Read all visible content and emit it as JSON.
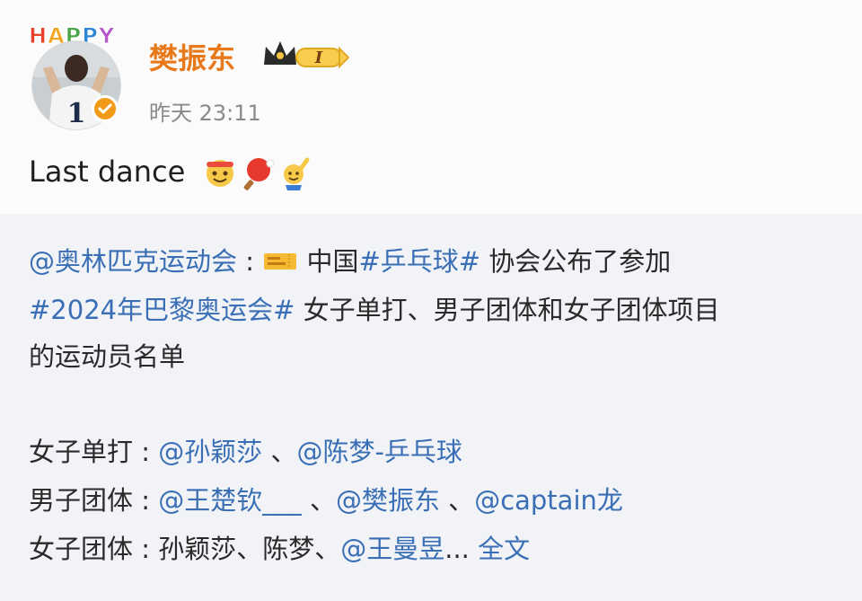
{
  "header": {
    "badge_text": "HAPPY",
    "username": "樊振东",
    "level_badge": "I",
    "timestamp": "昨天 23:11",
    "jersey_number": "1"
  },
  "post": {
    "text": "Last dance"
  },
  "repost": {
    "line1_mention": "@奥林匹克运动会",
    "line1_colon": " :",
    "line1_text1": " 中国",
    "line1_hashtag": "#乒乓球#",
    "line1_text2": " 协会公布了参加",
    "line2_hashtag": "#2024年巴黎奥运会#",
    "line2_text": " 女子单打、男子团体和女子团体项目",
    "line3_text": "的运动员名单",
    "line4_label": "女子单打 : ",
    "line4_m1": "@孙颖莎",
    "line4_sep": " 、",
    "line4_m2": "@陈梦-乒乓球",
    "line5_label": "男子团体 : ",
    "line5_m1": "@王楚钦___",
    "line5_sep1": " 、",
    "line5_m2": "@樊振东",
    "line5_sep2": " 、",
    "line5_m3": "@captain龙",
    "line6_label": "女子团体 : 孙颖莎、陈梦、",
    "line6_m1": "@王曼昱",
    "line6_ellipsis": "...",
    "line6_fulltext": " 全文"
  }
}
